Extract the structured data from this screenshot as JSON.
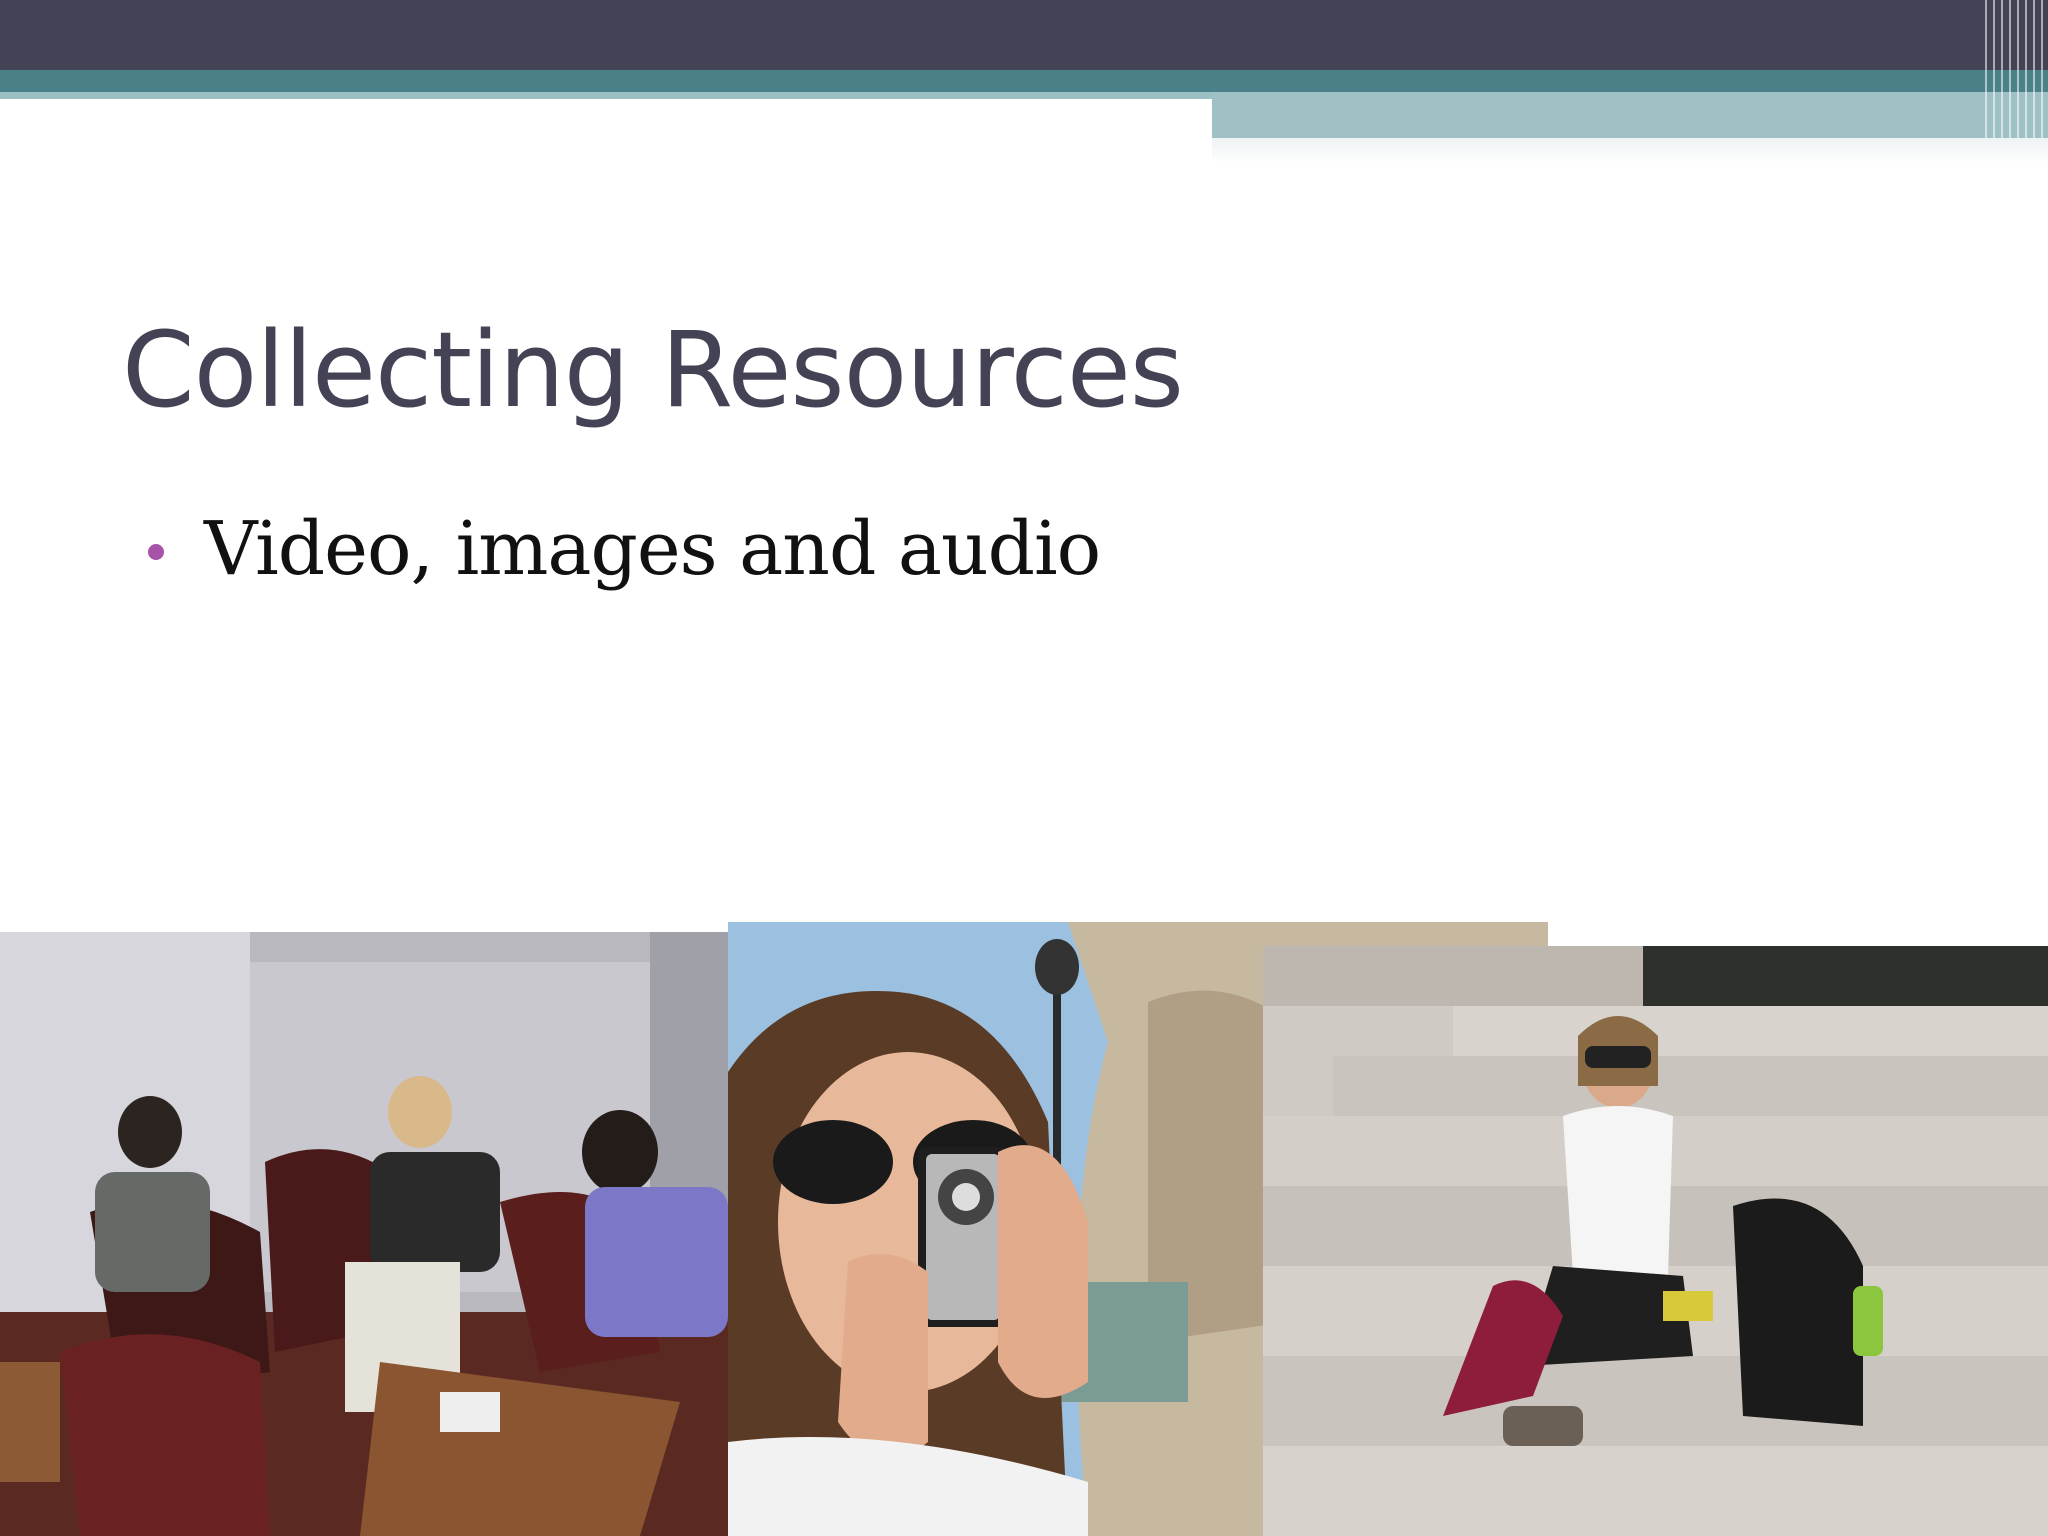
{
  "slide": {
    "title": "Collecting Resources",
    "bullets": [
      "Video, images and audio"
    ]
  },
  "photos": [
    {
      "name": "students-working-in-lounge-photo"
    },
    {
      "name": "woman-filming-with-camcorder-photo"
    },
    {
      "name": "woman-sitting-on-steps-photo"
    }
  ],
  "colors": {
    "header_dark": "#444355",
    "header_teal": "#4a8087",
    "header_light": "#9fc0c4",
    "title": "#444355",
    "bullet": "#a653a8"
  }
}
